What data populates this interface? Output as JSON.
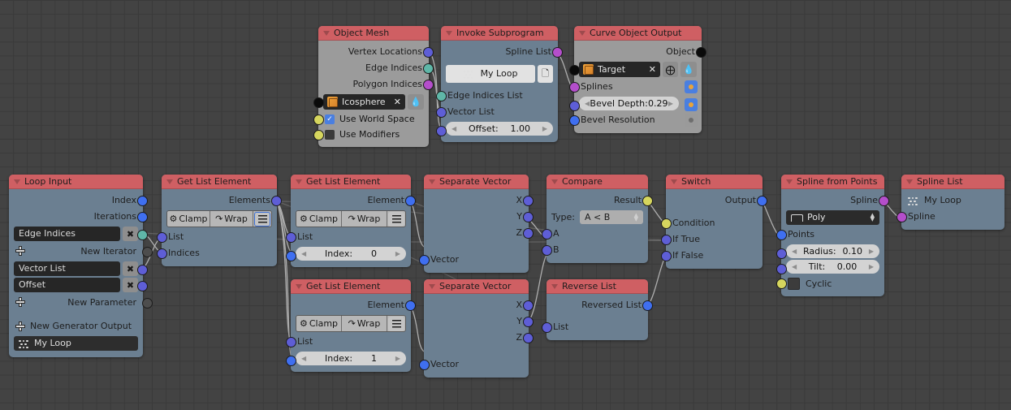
{
  "editor": {
    "name": "blender-animation-nodes-editor",
    "background_color": "#434343",
    "grid_color": "#3a3a3a",
    "header_color": "#cf5f63",
    "node_body_color": "#6b7f91",
    "node_body_gray": "#9b9b9b"
  },
  "nodes": [
    {
      "id": "object-mesh",
      "title": "Object Mesh",
      "outputs": [
        "Vertex Locations",
        "Edge Indices",
        "Polygon Indices"
      ],
      "object_field": "Icosphere",
      "checkbox_rows": [
        {
          "label": "Use World Space",
          "checked": true
        },
        {
          "label": "Use Modifiers",
          "checked": false
        }
      ]
    },
    {
      "id": "invoke-subprogram",
      "title": "Invoke Subprogram",
      "outputs": [
        "Spline List"
      ],
      "subprogram": "My Loop",
      "inputs": [
        "Edge Indices List",
        "Vector List"
      ],
      "slider": {
        "label": "Offset:",
        "value": "1.00"
      }
    },
    {
      "id": "curve-object-output",
      "title": "Curve Object Output",
      "outputs": [
        "Object"
      ],
      "object_field": "Target",
      "inputs": [
        "Splines",
        "Bevel Resolution"
      ],
      "slider": {
        "label": "Bevel Depth:",
        "value": "0.29"
      }
    },
    {
      "id": "loop-input",
      "title": "Loop Input",
      "outputs": [
        "Index",
        "Iterations"
      ],
      "iterator_fields": [
        "Edge Indices"
      ],
      "new_iterator": "New Iterator",
      "parameter_fields": [
        "Vector List",
        "Offset"
      ],
      "new_parameter": "New Parameter",
      "new_generator_output": "New Generator Output",
      "loop_name": "My Loop"
    },
    {
      "id": "get-list-element-1",
      "title": "Get List Element",
      "outputs": [
        "Elements"
      ],
      "toggles": [
        "Clamp",
        "Wrap"
      ],
      "inputs": [
        "List",
        "Indices"
      ]
    },
    {
      "id": "get-list-element-2",
      "title": "Get List Element",
      "outputs": [
        "Element"
      ],
      "toggles": [
        "Clamp",
        "Wrap"
      ],
      "inputs": [
        "List"
      ],
      "slider": {
        "label": "Index:",
        "value": "0"
      }
    },
    {
      "id": "get-list-element-3",
      "title": "Get List Element",
      "outputs": [
        "Element"
      ],
      "toggles": [
        "Clamp",
        "Wrap"
      ],
      "inputs": [
        "List"
      ],
      "slider": {
        "label": "Index:",
        "value": "1"
      }
    },
    {
      "id": "separate-vector-1",
      "title": "Separate Vector",
      "outputs": [
        "X",
        "Y",
        "Z"
      ],
      "inputs": [
        "Vector"
      ]
    },
    {
      "id": "separate-vector-2",
      "title": "Separate Vector",
      "outputs": [
        "X",
        "Y",
        "Z"
      ],
      "inputs": [
        "Vector"
      ]
    },
    {
      "id": "compare",
      "title": "Compare",
      "outputs": [
        "Result"
      ],
      "type_label": "Type:",
      "type_value": "A < B",
      "inputs": [
        "A",
        "B"
      ]
    },
    {
      "id": "reverse-list",
      "title": "Reverse List",
      "outputs": [
        "Reversed List"
      ],
      "inputs": [
        "List"
      ]
    },
    {
      "id": "switch",
      "title": "Switch",
      "outputs": [
        "Output"
      ],
      "inputs": [
        "Condition",
        "If True",
        "If False"
      ]
    },
    {
      "id": "spline-from-points",
      "title": "Spline from Points",
      "outputs": [
        "Spline"
      ],
      "spline_type": "Poly",
      "inputs": [
        "Points"
      ],
      "sliders": [
        {
          "label": "Radius:",
          "value": "0.10"
        },
        {
          "label": "Tilt:",
          "value": "0.00"
        }
      ],
      "cyclic_label": "Cyclic",
      "cyclic_checked": false
    },
    {
      "id": "spline-list",
      "title": "Spline List",
      "loop_name": "My Loop",
      "inputs": [
        "Spline"
      ]
    }
  ]
}
